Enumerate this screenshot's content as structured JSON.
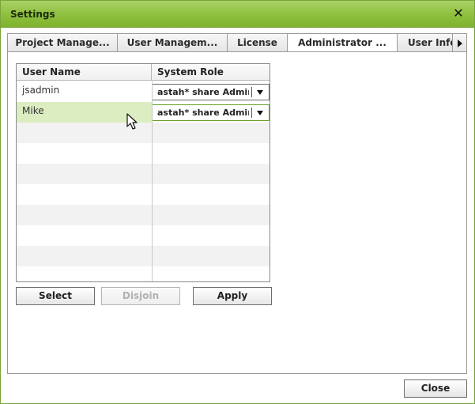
{
  "window": {
    "title": "Settings",
    "close_icon": "close-icon"
  },
  "tabs": [
    {
      "label": "Project Manage...",
      "active": false
    },
    {
      "label": "User Managem...",
      "active": false
    },
    {
      "label": "License",
      "active": false
    },
    {
      "label": "Administrator ...",
      "active": true
    },
    {
      "label": "User Info",
      "active": false
    }
  ],
  "tab_scroll_icon": "arrow-right-icon",
  "table": {
    "columns": [
      "User Name",
      "System Role"
    ],
    "rows": [
      {
        "user": "jsadmin",
        "role": "astah* share Admin"
      },
      {
        "user": "Mike",
        "role": "astah* share Admin",
        "selected": true
      }
    ]
  },
  "buttons": {
    "select": "Select",
    "disjoin": "Disjoin",
    "apply": "Apply",
    "close": "Close"
  },
  "colors": {
    "title_bar": "#8ec03e",
    "selected_row": "#dcedc1",
    "row_stripe": "#f2f2f2"
  }
}
